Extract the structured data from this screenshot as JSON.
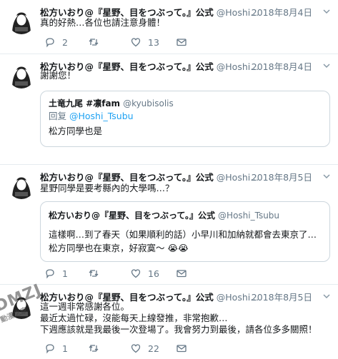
{
  "colors": {
    "reply_icon": "#657786",
    "retweet_icon": "#657786",
    "like_icon": "#657786",
    "link": "#1da1f2",
    "divider": "#e6ecf0"
  },
  "tweets": [
    {
      "name": "松方いおり@『星野、目をつぶって。』公式",
      "handle": "@Hoshi...",
      "date": "2018年8月4日",
      "lines": [
        "真的好熱…各位也請注意身體！"
      ],
      "replies": "2",
      "retweets": "",
      "likes": "13"
    },
    {
      "name": "松方いおり@『星野、目をつぶって。』公式",
      "handle": "@Hoshi...",
      "date": "2018年8月4日",
      "lines": [
        "謝謝您！"
      ],
      "quote": {
        "name": "土竜九尾 #凛fam",
        "handle": "@kyubisolis",
        "reply_prefix": "回复",
        "reply_target": "@Hoshi_Tsubu",
        "lines": [
          "松方同學也是"
        ]
      }
    },
    {
      "name": "松方いおり@『星野、目をつぶって。』公式",
      "handle": "@Hoshi...",
      "date": "2018年8月5日",
      "lines": [
        "星野同學是要考縣內的大學嗎…？"
      ],
      "quote": {
        "name": "松方いおり@『星野、目をつぶって。』公式",
        "handle": "@Hoshi_Tsubu",
        "lines": [
          "這樣啊…到了春天（如果順利的話）小早川和加納就都會去東京了…",
          "松方同學也在東京，好寂寞～ 😭😭"
        ]
      },
      "replies": "1",
      "retweets": "",
      "likes": "16"
    },
    {
      "name": "松方いおり@『星野、目をつぶって。』公式",
      "handle": "@Hoshi...",
      "date": "2018年8月5日",
      "lines": [
        "這一週非常感謝各位。",
        "最近太過忙碌，沒能每天上線發推，非常抱歉…",
        "下週應該就是我最後一次登場了。我會努力到最後，請各位多多關照！"
      ],
      "replies": "1",
      "retweets": "",
      "likes": "22"
    }
  ],
  "watermark": {
    "main": "DMZJ",
    "sub": "動漫之家"
  }
}
